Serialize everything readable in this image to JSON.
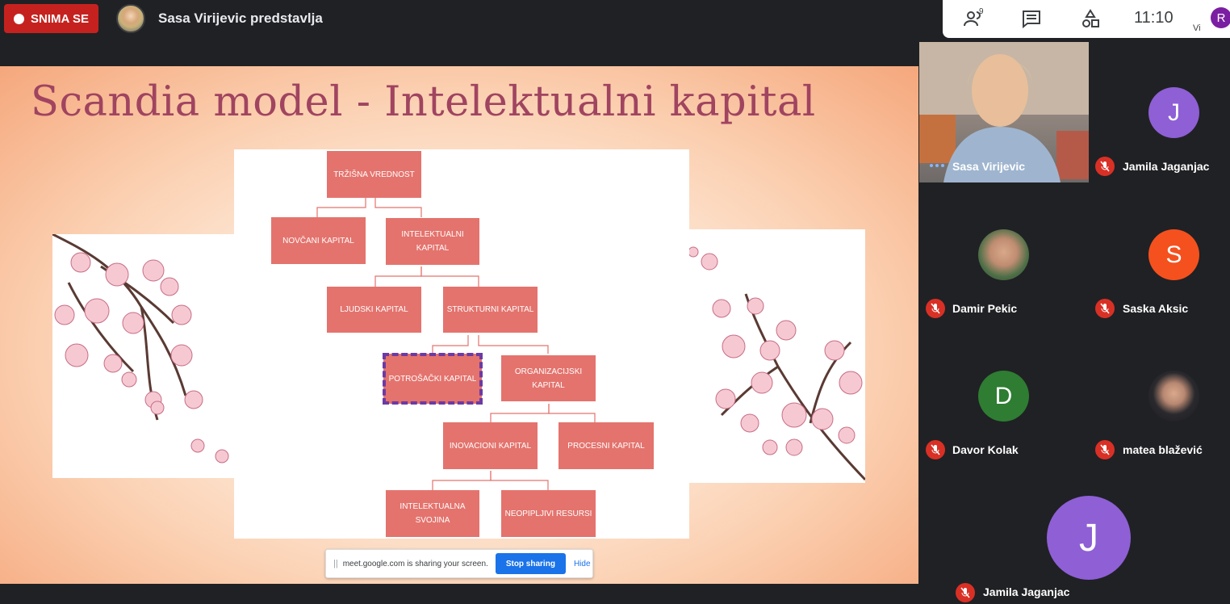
{
  "recording": {
    "label": "SNIMA SE"
  },
  "presenter": {
    "label": "Sasa Virijevic predstavlja"
  },
  "toolbar": {
    "participants_icon": "people-icon",
    "participant_count": "9",
    "chat_icon": "chat-icon",
    "activities_icon": "activities-icon",
    "time": "11:10",
    "self_initial": "R",
    "self_label": "Vi"
  },
  "slide": {
    "title": "Scandia model - Intelektualni kapital",
    "nodes": {
      "trzisna": "TRŽIŠNA VREDNOST",
      "novcani": "NOVČANI KAPITAL",
      "intelektualni": "INTELEKTUALNI KAPITAL",
      "ljudski": "LJUDSKI KAPITAL",
      "strukturni": "STRUKTURNI KAPITAL",
      "potrosacki": "POTROŠAČKI KAPITAL",
      "organizacijski": "ORGANIZACIJSKI KAPITAL",
      "inovacioni": "INOVACIONI KAPITAL",
      "procesni": "PROCESNI KAPITAL",
      "svojina": "INTELEKTUALNA SVOJINA",
      "resursi": "NEOPIPLJIVI RESURSI"
    },
    "node_color": "#e4736d",
    "title_color": "#a04460"
  },
  "share_bar": {
    "message": "meet.google.com is sharing your screen.",
    "stop_label": "Stop sharing",
    "hide_label": "Hide"
  },
  "participants": [
    {
      "name": "Sasa Virijevic",
      "muted": false,
      "initial": ""
    },
    {
      "name": "Jamila Jaganjac",
      "muted": true,
      "initial": "J",
      "color": "#8e5fd5"
    },
    {
      "name": "Damir Pekic",
      "muted": true,
      "initial": ""
    },
    {
      "name": "Saska Aksic",
      "muted": true,
      "initial": "S",
      "color": "#f4511e"
    },
    {
      "name": "Davor Kolak",
      "muted": true,
      "initial": "D",
      "color": "#2e7d32"
    },
    {
      "name": "matea blažević",
      "muted": true,
      "initial": ""
    },
    {
      "name": "Jamila Jaganjac",
      "muted": true,
      "initial": "J",
      "color": "#8e5fd5"
    }
  ]
}
